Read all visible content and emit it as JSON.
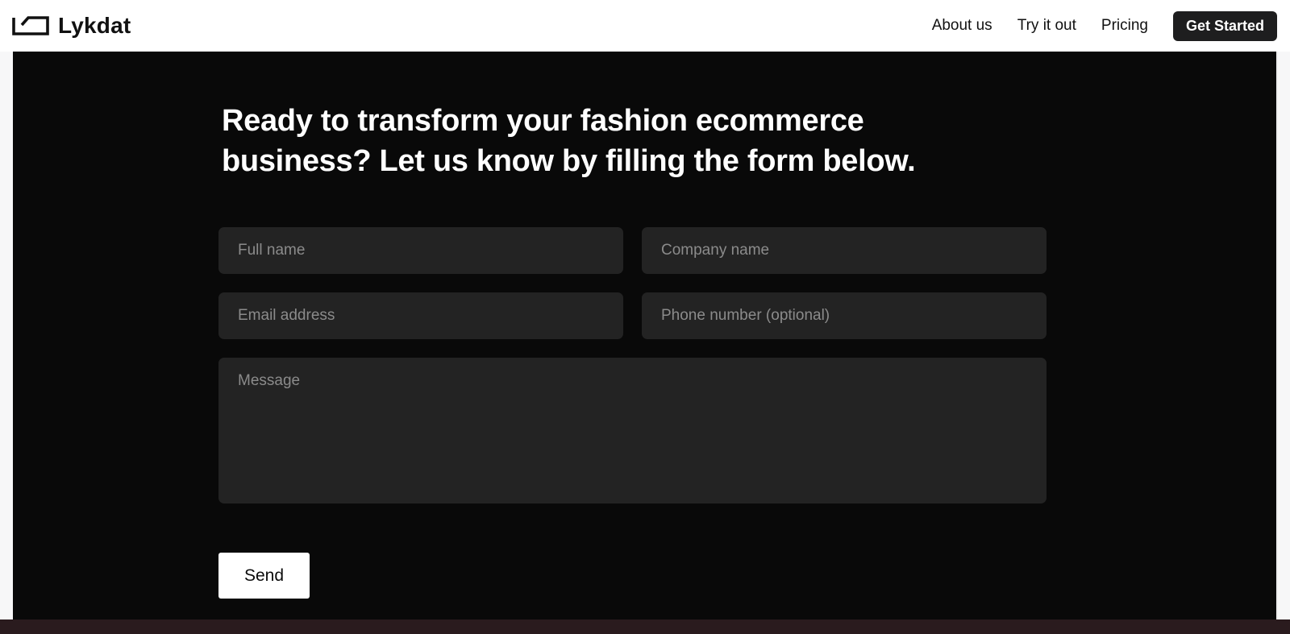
{
  "brand": {
    "name": "Lykdat",
    "icon": "lykdat-logo-icon"
  },
  "nav": {
    "links": [
      {
        "label": "About us"
      },
      {
        "label": "Try it out"
      },
      {
        "label": "Pricing"
      }
    ],
    "cta_label": "Get Started"
  },
  "hero": {
    "title": "Ready to transform your fashion ecommerce business? Let us know by filling the form below."
  },
  "form": {
    "full_name": {
      "value": "",
      "placeholder": "Full name"
    },
    "company_name": {
      "value": "",
      "placeholder": "Company name"
    },
    "email": {
      "value": "",
      "placeholder": "Email address"
    },
    "phone": {
      "value": "",
      "placeholder": "Phone number (optional)"
    },
    "message": {
      "value": "",
      "placeholder": "Message"
    },
    "send_label": "Send"
  },
  "colors": {
    "hero_background": "#090909",
    "field_background": "#232323",
    "cta_background": "#1e1e1f",
    "send_background": "#ffffff"
  }
}
